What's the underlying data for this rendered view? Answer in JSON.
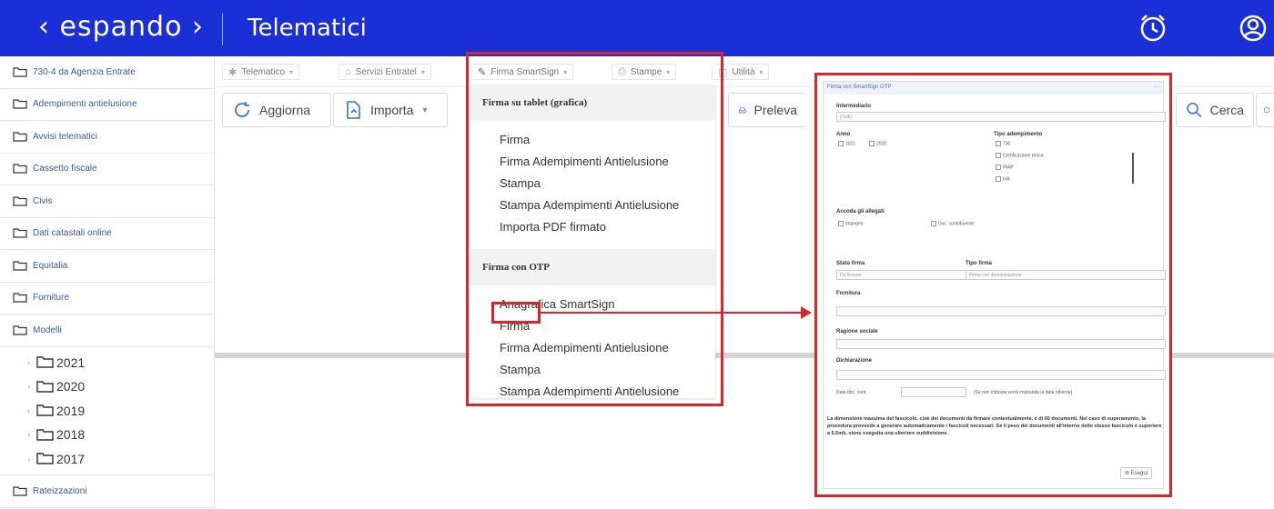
{
  "header": {
    "logo": "‹ espando ›",
    "title": "Telematici",
    "alarm_icon": "alarm-clock-icon",
    "user_icon": "user-account-icon",
    "bg_color": "#1a2fd6"
  },
  "sidebar": {
    "items_top": [
      {
        "label": "730-4 da Agenzia Entrate"
      },
      {
        "label": "Adempimenti antielusione"
      },
      {
        "label": "Avvisi telematici"
      },
      {
        "label": "Cassetto fiscale"
      },
      {
        "label": "Civis"
      },
      {
        "label": "Dati catastali online"
      },
      {
        "label": "Equitalia"
      },
      {
        "label": "Forniture"
      },
      {
        "label": "Modelli"
      }
    ],
    "years": [
      "2021",
      "2020",
      "2019",
      "2018",
      "2017"
    ],
    "items_bottom": [
      {
        "label": "Rateizzazioni"
      }
    ]
  },
  "toolbar1": {
    "telematico": "Telematico",
    "servizi": "Servizi Entratel",
    "firma": "Firma SmartSign",
    "stampe": "Stampe",
    "utilita": "Utilità"
  },
  "toolbar2": {
    "aggiorna": "Aggiorna",
    "importa": "Importa",
    "preleva": "Preleva",
    "cerca": "Cerca"
  },
  "menu": {
    "section1": "Firma su tablet (grafica)",
    "items1": [
      "Firma",
      "Firma Adempimenti Antielusione",
      "Stampa",
      "Stampa Adempimenti Antielusione",
      "Importa PDF firmato"
    ],
    "section2": "Firma con OTP",
    "items2": [
      "Anagrafica SmartSign",
      "Firma",
      "Firma Adempimenti Antielusione",
      "Stampa",
      "Stampa Adempimenti Antielusione"
    ]
  },
  "dialog": {
    "title": "Firma con SmartSign OTP",
    "intermediario_label": "Intermediario",
    "intermediario_value": "(Tutti)",
    "anno_label": "Anno",
    "anni": [
      "2021",
      "2020"
    ],
    "tipo_label": "Tipo adempimento",
    "tipi": [
      "730",
      "Certificazione Unica",
      "IRAP",
      "IVA"
    ],
    "allegati_label": "Accoda gli allegati",
    "allegati": [
      "Impegno",
      "Doc. contribuente"
    ],
    "stato_label": "Stato firma",
    "stato_value": "Da firmare",
    "tipo_firma_label": "Tipo firma",
    "tipo_firma_value": "Firma con denominazione",
    "fornitura_label": "Fornitura",
    "ragione_label": "Ragione sociale",
    "dichiarazione_label": "Dichiarazione",
    "data_label": "Data doc. cont.",
    "data_hint": "(Se non indicata verrà impostata la data odierna)",
    "note": "La dimensione massima del fascicolo, cioè dei documenti da firmare contestualmente, è di 60 documenti. Nel caso di superamento, la procedura provvede a generare automaticamente i fascicoli necessari. Se il peso dei documenti all'interno dello stesso fascicolo è superiore a 6.5mb, viene eseguita una ulteriore suddivisione.",
    "button": "Esegui"
  }
}
